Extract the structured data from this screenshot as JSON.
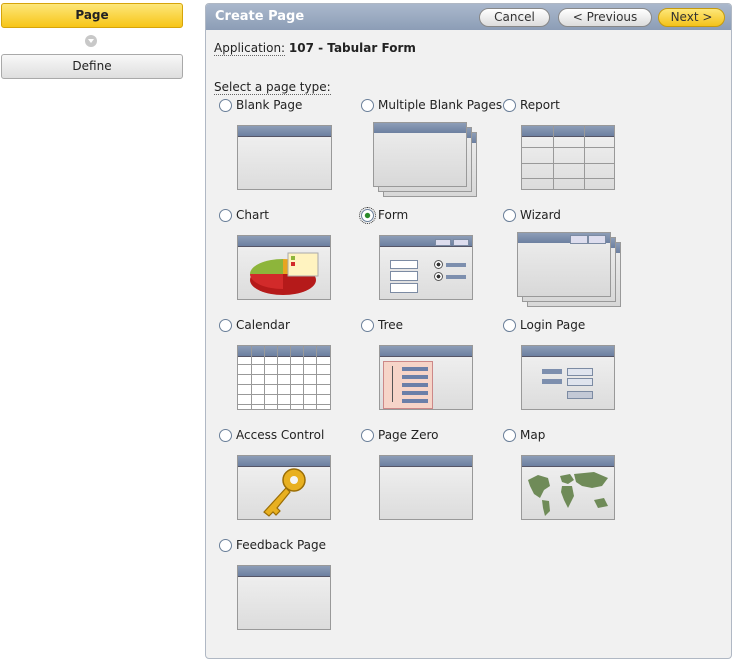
{
  "steps": {
    "current": "Page",
    "next": "Define"
  },
  "panel": {
    "title": "Create Page",
    "cancel": "Cancel",
    "previous": "< Previous",
    "next": "Next >",
    "app_label": "Application:",
    "app_value": "107 - Tabular Form",
    "select_label": "Select a page type:"
  },
  "options": [
    {
      "label": "Blank Page",
      "icon": "blank-page-icon",
      "checked": false
    },
    {
      "label": "Multiple Blank Pages",
      "icon": "multiple-pages-icon",
      "checked": false
    },
    {
      "label": "Report",
      "icon": "report-icon",
      "checked": false
    },
    {
      "label": "Chart",
      "icon": "chart-icon",
      "checked": false
    },
    {
      "label": "Form",
      "icon": "form-icon",
      "checked": true
    },
    {
      "label": "Wizard",
      "icon": "wizard-icon",
      "checked": false
    },
    {
      "label": "Calendar",
      "icon": "calendar-icon",
      "checked": false
    },
    {
      "label": "Tree",
      "icon": "tree-icon",
      "checked": false
    },
    {
      "label": "Login Page",
      "icon": "login-icon",
      "checked": false
    },
    {
      "label": "Access Control",
      "icon": "key-icon",
      "checked": false
    },
    {
      "label": "Page Zero",
      "icon": "page-zero-icon",
      "checked": false
    },
    {
      "label": "Map",
      "icon": "map-icon",
      "checked": false
    },
    {
      "label": "Feedback Page",
      "icon": "feedback-icon",
      "checked": false
    }
  ],
  "colors": {
    "accent": "#f7c517",
    "header": "#8c9db6"
  }
}
